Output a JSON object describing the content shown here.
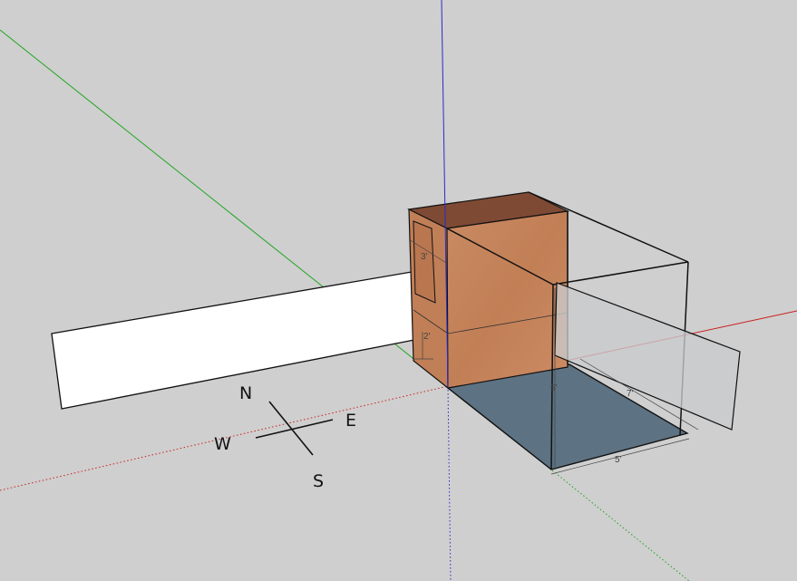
{
  "viewport": {
    "background": "#cfcfcf",
    "axis_colors": {
      "red": "#cc1f1f",
      "green": "#1fa51f",
      "blue": "#2b2bcc"
    }
  },
  "model": {
    "wood_color": "#c8845c",
    "floor_color": "#5d7282",
    "glass_color": "#c9cbcd"
  },
  "dimensions": {
    "window_height": "3'",
    "sill_height": "2'",
    "room_depth": "7'",
    "room_width": "5'",
    "room_height": "5'"
  },
  "compass": {
    "north": "N",
    "east": "E",
    "south": "S",
    "west": "W"
  }
}
